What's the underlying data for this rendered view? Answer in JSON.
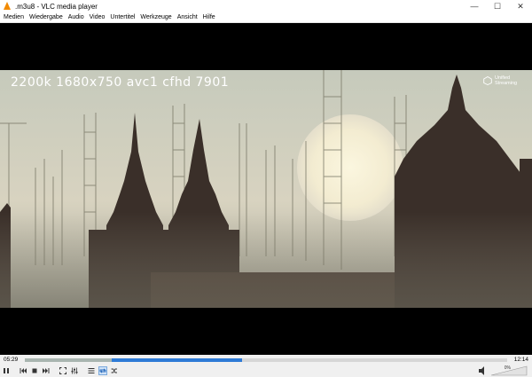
{
  "window": {
    "title": ".m3u8 - VLC media player",
    "minimize_glyph": "—",
    "maximize_glyph": "☐",
    "close_glyph": "✕"
  },
  "menu": {
    "items": [
      "Medien",
      "Wiedergabe",
      "Audio",
      "Video",
      "Untertitel",
      "Werkzeuge",
      "Ansicht",
      "Hilfe"
    ]
  },
  "video": {
    "overlay_text": "2200k  1680x750 avc1 cfhd 7901",
    "brand_text": "Unified Streaming"
  },
  "playback": {
    "elapsed": "05:29",
    "total": "12:14",
    "progress_fraction": 0.45,
    "buffer_fraction": 0.18,
    "volume_percent": "0%",
    "volume_fraction": 0.0
  },
  "icons": {
    "play": "play-icon",
    "prev": "previous-icon",
    "stop": "stop-icon",
    "next": "next-icon",
    "fullscreen": "fullscreen-icon",
    "extended": "extended-settings-icon",
    "playlist": "playlist-icon",
    "loop": "loop-icon",
    "shuffle": "shuffle-icon"
  },
  "colors": {
    "accent": "#2e7bd6",
    "vlc_orange": "#f28a00"
  }
}
